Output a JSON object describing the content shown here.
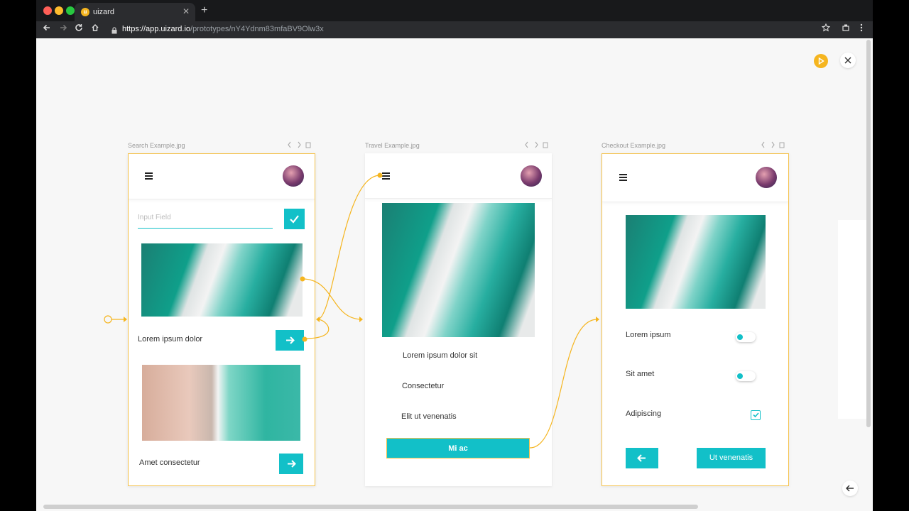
{
  "browser": {
    "tab_title": "uizard",
    "tab_favicon_letter": "u",
    "close_glyph": "✕",
    "new_tab_glyph": "+",
    "url_host": "https://app.uizard.io",
    "url_path": "/prototypes/nY4Ydnm83mfaBV9Olw3x",
    "traffic_colors": [
      "#ff5f57",
      "#febc2e",
      "#28c840"
    ]
  },
  "canvas": {
    "frames": [
      {
        "label": "Search Example.jpg",
        "input_placeholder": "Input Field",
        "item1_label": "Lorem ipsum dolor",
        "item2_label": "Amet consectetur"
      },
      {
        "label": "Travel Example.jpg",
        "list": [
          "Lorem ipsum dolor sit",
          "Consectetur",
          "Elit ut venenatis"
        ],
        "button_label": "Mi ac"
      },
      {
        "label": "Checkout Example.jpg",
        "toggle1_label": "Lorem ipsum",
        "toggle2_label": "Sit amet",
        "checkbox_label": "Adipiscing",
        "cta_label": "Ut venenatis"
      }
    ]
  },
  "colors": {
    "accent": "#12c0c8",
    "selection": "#f5c24b",
    "link": "#f5b51f"
  }
}
